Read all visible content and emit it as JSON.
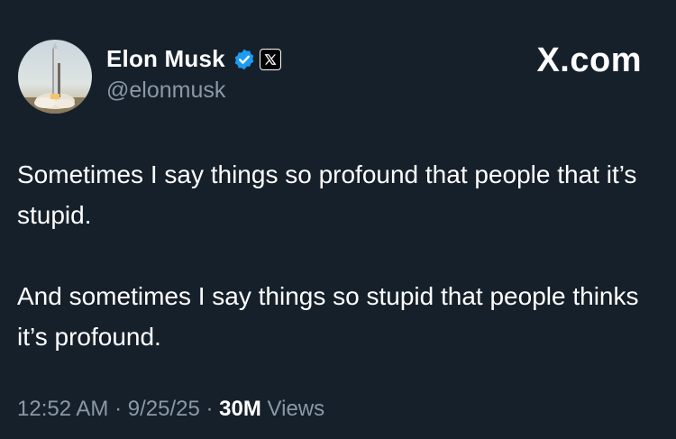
{
  "author": {
    "name": "Elon Musk",
    "handle": "@elonmusk",
    "verified_color": "#1d9bf0"
  },
  "brand": "X.com",
  "tweet": {
    "paragraphs": [
      "Sometimes I say things so profound that people that it’s stupid.",
      "And sometimes I say things so stupid that people thinks it’s profound."
    ]
  },
  "meta": {
    "time": "12:52 AM",
    "separator": "·",
    "date": "9/25/25",
    "views_count": "30M",
    "views_label": "Views"
  },
  "colors": {
    "background": "#16202b",
    "text_primary": "#ffffff",
    "text_secondary": "#8b98a5"
  },
  "icons": {
    "verified": "verified-badge-icon",
    "affiliate": "x-logo-icon"
  }
}
